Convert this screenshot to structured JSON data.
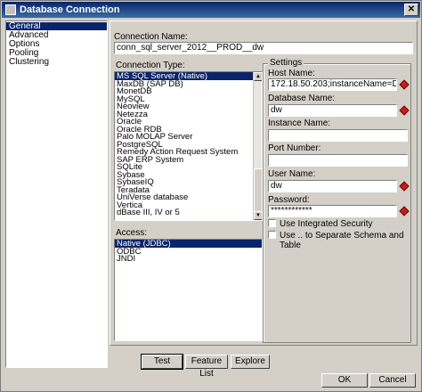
{
  "window": {
    "title": "Database Connection",
    "close_glyph": "✕"
  },
  "nav": {
    "items": [
      "General",
      "Advanced",
      "Options",
      "Pooling",
      "Clustering"
    ],
    "selected": 0
  },
  "connection_name": {
    "label": "Connection Name:",
    "value": "conn_sql_server_2012__PROD__dw"
  },
  "connection_type": {
    "label": "Connection Type:",
    "items": [
      "MS SQL Server (Native)",
      "MaxDB (SAP DB)",
      "MonetDB",
      "MySQL",
      "Neoview",
      "Netezza",
      "Oracle",
      "Oracle RDB",
      "Palo MOLAP Server",
      "PostgreSQL",
      "Remedy Action Request System",
      "SAP ERP System",
      "SQLite",
      "Sybase",
      "SybaseIQ",
      "Teradata",
      "UniVerse database",
      "Vertica",
      "dBase III, IV or 5"
    ],
    "selected": 0
  },
  "access": {
    "label": "Access:",
    "items": [
      "Native (JDBC)",
      "ODBC",
      "JNDI"
    ],
    "selected": 0
  },
  "settings": {
    "title": "Settings",
    "host_label": "Host Name:",
    "host_value": "172.18.50.203;instanceName=DW",
    "db_label": "Database Name:",
    "db_value": "dw",
    "instance_label": "Instance Name:",
    "instance_value": "",
    "port_label": "Port Number:",
    "port_value": "",
    "user_label": "User Name:",
    "user_value": "dw",
    "password_label": "Password:",
    "password_value": "************",
    "integrated_label": "Use Integrated Security",
    "separate_label": "Use .. to Separate Schema and Table"
  },
  "buttons": {
    "test": "Test",
    "feature_list": "Feature List",
    "explore": "Explore",
    "ok": "OK",
    "cancel": "Cancel"
  }
}
